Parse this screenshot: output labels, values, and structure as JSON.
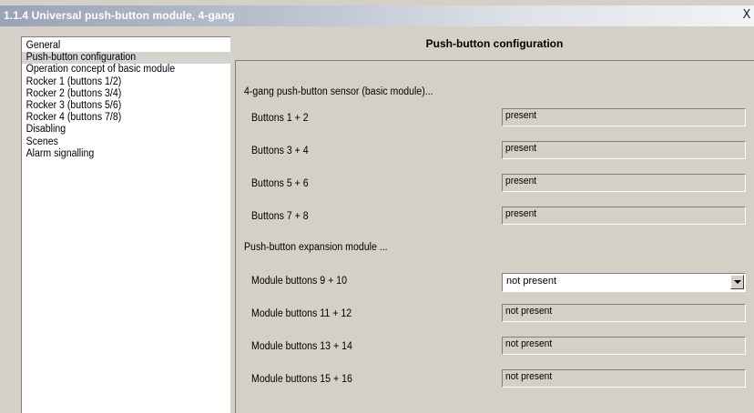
{
  "window": {
    "title": "1.1.4 Universal push-button module, 4-gang",
    "close_glyph": "X"
  },
  "nav": {
    "items": [
      {
        "label": "General"
      },
      {
        "label": "Push-button configuration"
      },
      {
        "label": "Operation concept of basic module"
      },
      {
        "label": "Rocker 1 (buttons 1/2)"
      },
      {
        "label": "Rocker 2 (buttons 3/4)"
      },
      {
        "label": "Rocker 3 (buttons 5/6)"
      },
      {
        "label": "Rocker 4 (buttons 7/8)"
      },
      {
        "label": "Disabling"
      },
      {
        "label": "Scenes"
      },
      {
        "label": "Alarm signalling"
      }
    ],
    "selected_index": 1
  },
  "panel": {
    "header": "Push-button configuration",
    "basic_section": "4-gang push-button sensor (basic module)...",
    "basic_rows": [
      {
        "label": "Buttons 1 + 2",
        "value": "present"
      },
      {
        "label": "Buttons 3 + 4",
        "value": "present"
      },
      {
        "label": "Buttons 5 + 6",
        "value": "present"
      },
      {
        "label": "Buttons 7 + 8",
        "value": "present"
      }
    ],
    "expansion_section": "Push-button expansion module ...",
    "expansion_rows": [
      {
        "label": "Module buttons 9 + 10",
        "value": "not present",
        "type": "dropdown"
      },
      {
        "label": "Module buttons 11 + 12",
        "value": "not present"
      },
      {
        "label": "Module buttons 13 + 14",
        "value": "not present"
      },
      {
        "label": "Module buttons 15 + 16",
        "value": "not present"
      }
    ]
  }
}
